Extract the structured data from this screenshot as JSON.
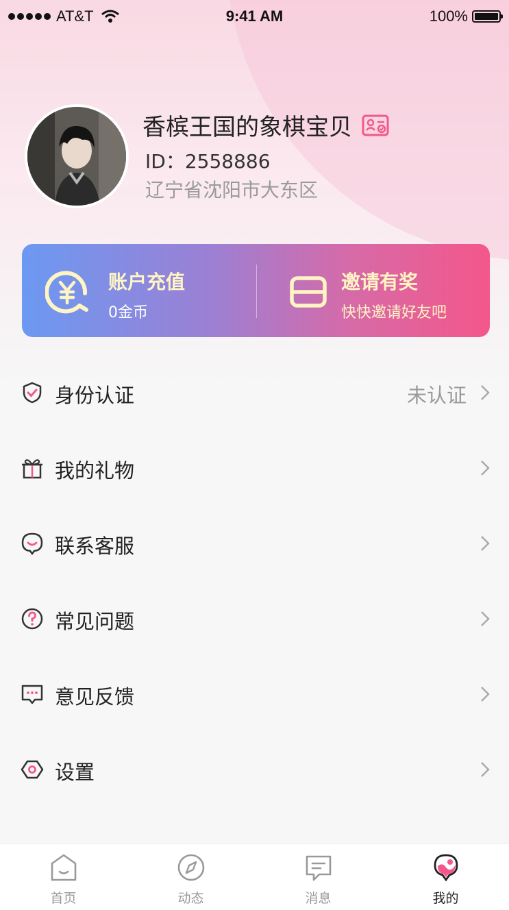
{
  "status_bar": {
    "carrier": "AT&T",
    "time": "9:41 AM",
    "battery": "100%",
    "battery_level": 1.0
  },
  "profile": {
    "name": "香槟王国的象棋宝贝",
    "id": "ID：2558886",
    "location": "辽宁省沈阳市大东区",
    "badge_icon": "id-card-icon"
  },
  "card": {
    "recharge": {
      "title": "账户充值",
      "sub": "0金币",
      "icon": "yuan-coin-icon"
    },
    "invite": {
      "title": "邀请有奖",
      "sub": "快快邀请好友吧",
      "icon": "envelope-icon"
    }
  },
  "menu": [
    {
      "label": "身份认证",
      "status": "未认证",
      "icon": "shield-check-icon"
    },
    {
      "label": "我的礼物",
      "status": "",
      "icon": "gift-icon"
    },
    {
      "label": "联系客服",
      "status": "",
      "icon": "customer-service-icon"
    },
    {
      "label": "常见问题",
      "status": "",
      "icon": "question-icon"
    },
    {
      "label": "意见反馈",
      "status": "",
      "icon": "feedback-icon"
    },
    {
      "label": "设置",
      "status": "",
      "icon": "settings-icon"
    }
  ],
  "tabs": [
    {
      "label": "首页",
      "icon": "home-icon",
      "active": false
    },
    {
      "label": "动态",
      "icon": "compass-icon",
      "active": false
    },
    {
      "label": "消息",
      "icon": "message-icon",
      "active": false
    },
    {
      "label": "我的",
      "icon": "profile-icon",
      "active": true
    }
  ],
  "colors": {
    "accent": "#f4578a",
    "gradient_start": "#6c99f2",
    "gradient_end": "#f4578a",
    "gold": "#fff4c4"
  }
}
